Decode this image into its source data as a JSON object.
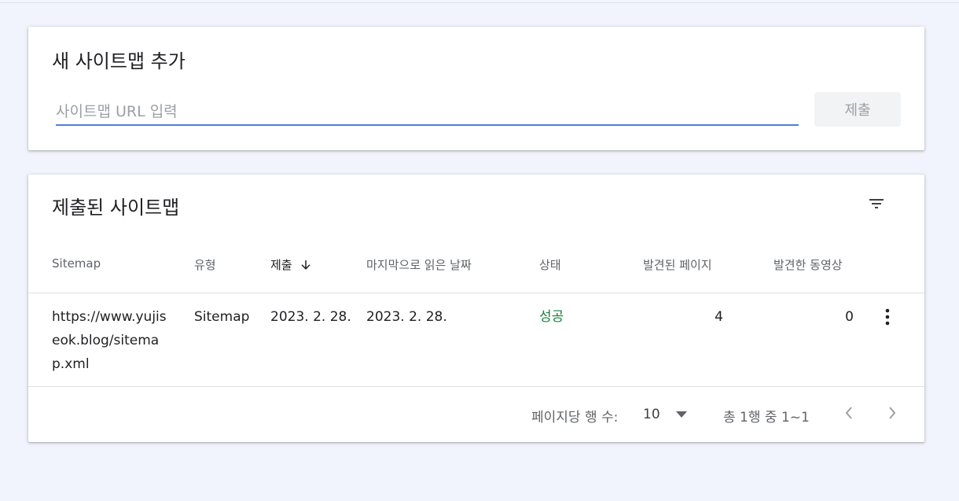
{
  "add_card": {
    "title": "새 사이트맵 추가",
    "url_placeholder": "사이트맵 URL 입력",
    "submit_label": "제출"
  },
  "list_card": {
    "title": "제출된 사이트맵",
    "columns": {
      "sitemap": "Sitemap",
      "type": "유형",
      "submitted": "제출",
      "last_read": "마지막으로 읽은 날짜",
      "status": "상태",
      "pages": "발견된 페이지",
      "videos": "발견한 동영상"
    },
    "rows": [
      {
        "sitemap": "https://www.yujiseok.blog/sitemap.xml",
        "type": "Sitemap",
        "submitted": "2023. 2. 28.",
        "last_read": "2023. 2. 28.",
        "status": "성공",
        "pages": "4",
        "videos": "0"
      }
    ],
    "footer": {
      "rows_per_page_label": "페이지당 행 수:",
      "rows_per_page_value": "10",
      "range_text": "총 1행 중 1~1"
    }
  },
  "colors": {
    "background": "#f1f4fc",
    "input_underline": "#4f7fd6",
    "status_success": "#188038"
  },
  "icons": {
    "filter": "filter-icon",
    "sort": "arrow-down-icon",
    "more": "more-vert-icon",
    "dropdown": "caret-down-icon",
    "prev": "chevron-left-icon",
    "next": "chevron-right-icon"
  }
}
